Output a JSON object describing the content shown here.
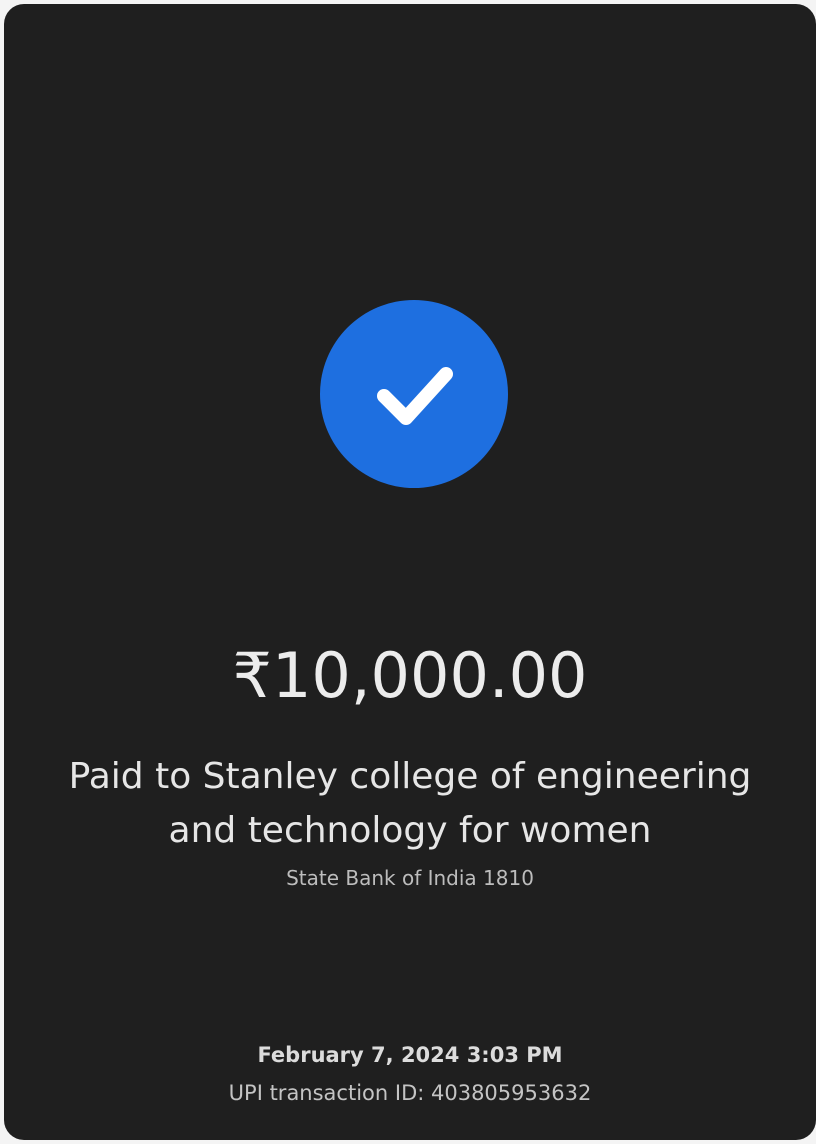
{
  "status": {
    "icon": "check-icon",
    "color": "#1e6fe0"
  },
  "payment": {
    "amount": "₹10,000.00",
    "payee": "Paid to Stanley college of engineering and technology for women",
    "bank": "State Bank of India 1810",
    "datetime": "February 7, 2024 3:03 PM",
    "transaction_id": "UPI transaction ID: 403805953632"
  }
}
